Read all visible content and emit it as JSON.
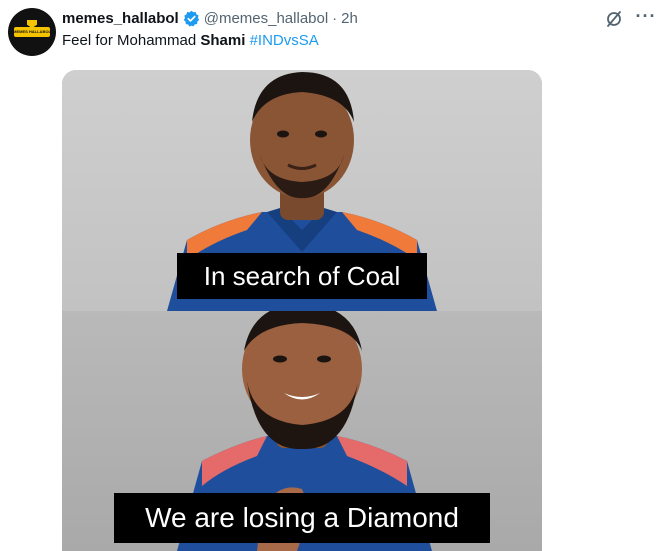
{
  "author": {
    "display_name": "memes_hallabol",
    "handle": "@memes_hallabol",
    "separator": "·",
    "time": "2h",
    "avatar_text": "MEMES HALLABOL"
  },
  "tweet": {
    "text_before": "Feel for Mohammad ",
    "text_bold": "Shami",
    "text_space": " ",
    "hashtag": "#INDvsSA"
  },
  "media": {
    "top_caption": "In search of Coal",
    "bottom_caption": "We are losing a Diamond"
  },
  "icons": {
    "verified": "verified-badge-icon",
    "grok": "grok-icon",
    "more": "more-options-icon"
  },
  "colors": {
    "link": "#1d9bf0",
    "muted": "#536471",
    "verified": "#1d9bf0"
  }
}
